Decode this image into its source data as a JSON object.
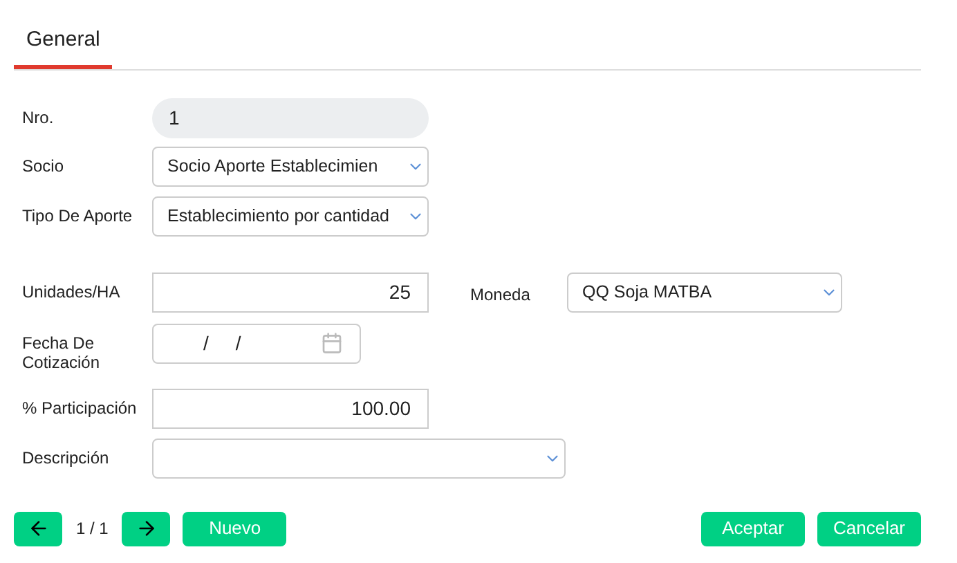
{
  "tabs": [
    {
      "label": "General",
      "selected": true
    }
  ],
  "fields": [
    {
      "label": "Nro.",
      "kind": "readonly",
      "value": "1"
    },
    {
      "label": "Socio",
      "kind": "select",
      "value": "Socio Aporte Establecimien"
    },
    {
      "label": "Tipo De Aporte",
      "kind": "select",
      "value": "Establecimiento por cantidad"
    },
    {
      "label": "Unidades/HA",
      "kind": "number",
      "value": "25",
      "side": {
        "label": "Moneda",
        "kind": "select",
        "value": "QQ Soja MATBA"
      }
    },
    {
      "label": "Fecha De Cotización",
      "kind": "date",
      "value": "/     /"
    },
    {
      "label": "% Participación",
      "kind": "number",
      "value": "100.00"
    },
    {
      "label": "Descripción",
      "kind": "wideselect"
    }
  ],
  "pager": {
    "text": "1 / 1"
  },
  "buttons": {
    "new": "Nuevo",
    "accept": "Aceptar",
    "cancel": "Cancelar"
  }
}
